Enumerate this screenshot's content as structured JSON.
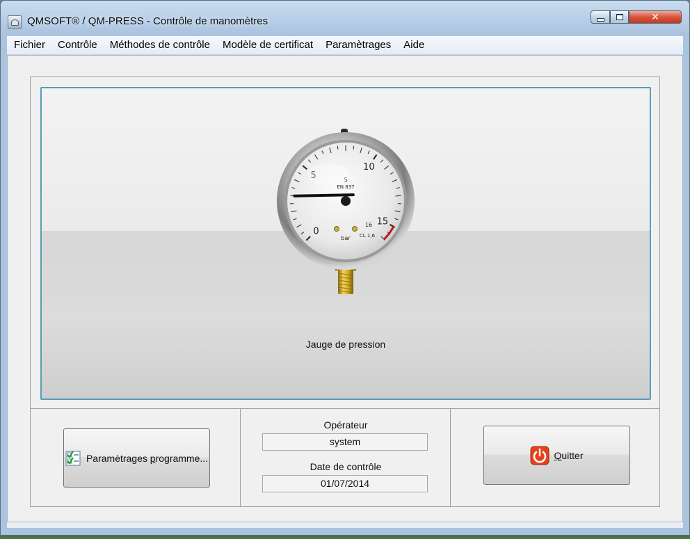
{
  "window": {
    "title": "QMSOFT® / QM-PRESS - Contrôle de manomètres",
    "controls": {
      "close": "✕"
    }
  },
  "menu": {
    "items": [
      {
        "name": "fichier",
        "label": "Fichier"
      },
      {
        "name": "controle",
        "label": "Contrôle"
      },
      {
        "name": "methodes",
        "label": "Méthodes de contrôle"
      },
      {
        "name": "modele",
        "label": "Modèle de certificat"
      },
      {
        "name": "parametrages",
        "label": "Paramètrages"
      },
      {
        "name": "aide",
        "label": "Aide"
      }
    ]
  },
  "gauge": {
    "caption": "Jauge de pression",
    "dial_labels": {
      "n0": "0",
      "n5": "5",
      "n10": "10",
      "n15": "15",
      "n16": "16"
    },
    "unit": "bar",
    "standard": "EN 837",
    "symbol": "S",
    "class": "CL 1,6",
    "needle_value": 3
  },
  "footer": {
    "settings_button": {
      "label_pre": "Paramètrages ",
      "label_ul": "p",
      "label_post": "rogramme...",
      "icon": "checklist-icon"
    },
    "operator": {
      "label": "Opérateur",
      "value": "system"
    },
    "date": {
      "label": "Date de contrôle",
      "value": "01/07/2014"
    },
    "quit_button": {
      "label_ul": "Q",
      "label_post": "uitter",
      "icon": "power-icon"
    }
  },
  "colors": {
    "frame_border": "#5c9bb8",
    "quit_icon": "#e8401c",
    "close_button": "#c33a20"
  }
}
